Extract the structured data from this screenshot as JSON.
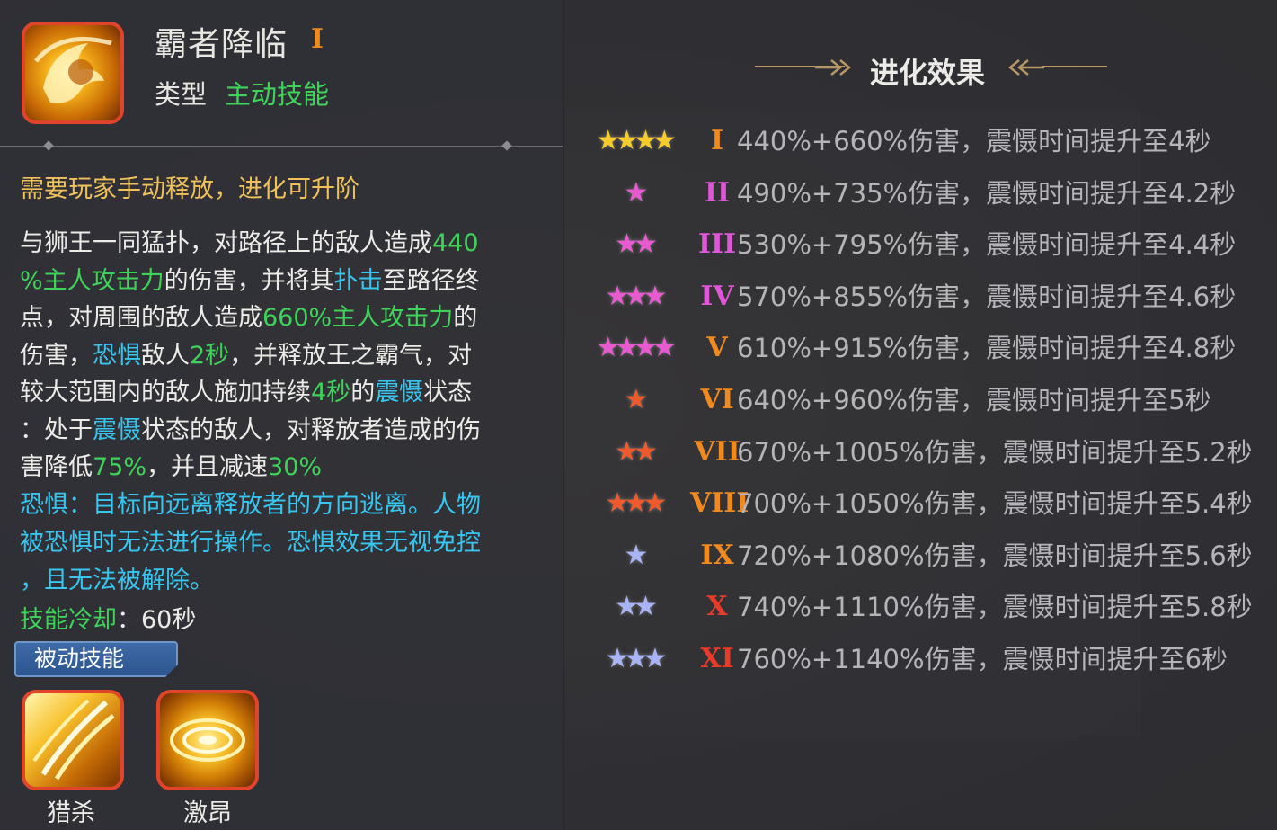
{
  "skill": {
    "name": "霸者降临",
    "rank": "I",
    "type_label": "类型",
    "type_value": "主动技能",
    "icon": "lion-golden-skill-icon"
  },
  "description": {
    "note": "需要玩家手动释放，进化可升阶",
    "line1_a": "与狮王一同猛扑，对路径上的敌人造成",
    "line1_b": "440",
    "line2_a": "%主人攻击力",
    "line2_b": "的伤害，并将其",
    "line2_c": "扑击",
    "line2_d": "至路径终",
    "line3_a": "点，对周围的敌人造成",
    "line3_b": "660%主人攻击力",
    "line3_c": "的",
    "line4_a": "伤害，",
    "line4_b": "恐惧",
    "line4_c": "敌人",
    "line4_d": "2秒",
    "line4_e": "，并释放王之霸气，对",
    "line5_a": "较大范围内的敌人施加持续",
    "line5_b": "4秒",
    "line5_c": "的",
    "line5_d": "震慑",
    "line5_e": "状态",
    "line6_a": "：处于",
    "line6_b": "震慑",
    "line6_c": "状态的敌人，对释放者造成的伤",
    "line7_a": "害降低",
    "line7_b": "75%",
    "line7_c": "，并且减速",
    "line7_d": "30%",
    "fear_line1": "恐惧：目标向远离释放者的方向逃离。人物",
    "fear_line2": "被恐惧时无法进行操作。恐惧效果无视免控",
    "fear_line3": "，且无法被解除。",
    "cooldown_key": "技能冷却",
    "cooldown_value": "：60秒"
  },
  "passive": {
    "tag": "被动技能",
    "skills": [
      {
        "name": "猎杀",
        "icon": "claw-slash-icon"
      },
      {
        "name": "激昂",
        "icon": "golden-swirl-icon"
      }
    ]
  },
  "evolution": {
    "title": "进化效果",
    "rows": [
      {
        "stars": "★★★★",
        "star_color": "#f5cc2a",
        "numeral": "I",
        "numeral_color": "#f08a1f",
        "effect": "440%+660%伤害，震慑时间提升至4秒"
      },
      {
        "stars": "★",
        "star_color": "#e85ad0",
        "numeral": "II",
        "numeral_color": "#e056d8",
        "effect": "490%+735%伤害，震慑时间提升至4.2秒"
      },
      {
        "stars": "★★",
        "star_color": "#e85ad0",
        "numeral": "III",
        "numeral_color": "#e056d8",
        "effect": "530%+795%伤害，震慑时间提升至4.4秒"
      },
      {
        "stars": "★★★",
        "star_color": "#e85ad0",
        "numeral": "IV",
        "numeral_color": "#e056d8",
        "effect": "570%+855%伤害，震慑时间提升至4.6秒"
      },
      {
        "stars": "★★★★",
        "star_color": "#e85ad0",
        "numeral": "V",
        "numeral_color": "#f08a1f",
        "effect": "610%+915%伤害，震慑时间提升至4.8秒"
      },
      {
        "stars": "★",
        "star_color": "#ef5a2c",
        "numeral": "VI",
        "numeral_color": "#f08a1f",
        "effect": "640%+960%伤害，震慑时间提升至5秒"
      },
      {
        "stars": "★★",
        "star_color": "#ef5a2c",
        "numeral": "VII",
        "numeral_color": "#f08a1f",
        "effect": "670%+1005%伤害，震慑时间提升至5.2秒"
      },
      {
        "stars": "★★★",
        "star_color": "#ef5a2c",
        "numeral": "VIII",
        "numeral_color": "#f08a1f",
        "effect": "700%+1050%伤害，震慑时间提升至5.4秒"
      },
      {
        "stars": "★",
        "star_color": "#a8b4f5",
        "numeral": "IX",
        "numeral_color": "#f08a1f",
        "effect": "720%+1080%伤害，震慑时间提升至5.6秒"
      },
      {
        "stars": "★★",
        "star_color": "#a8b4f5",
        "numeral": "X",
        "numeral_color": "#e83b2a",
        "effect": "740%+1110%伤害，震慑时间提升至5.8秒"
      },
      {
        "stars": "★★★",
        "star_color": "#a8b4f5",
        "numeral": "XI",
        "numeral_color": "#e83b2a",
        "effect": "760%+1140%伤害，震慑时间提升至6秒"
      }
    ]
  }
}
